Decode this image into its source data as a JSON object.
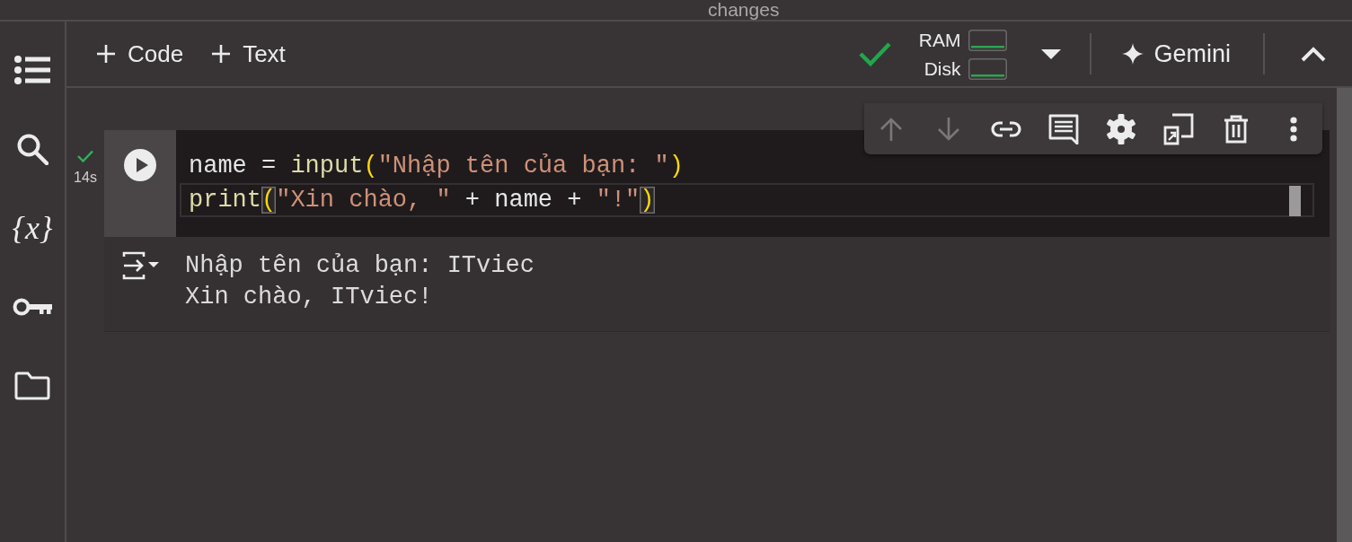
{
  "header": {
    "text": "changes"
  },
  "sidebar": {
    "variables_label": "{x}"
  },
  "toolbar": {
    "buttons": [
      {
        "label": "Code"
      },
      {
        "label": "Text"
      }
    ],
    "runtime": {
      "connected": true,
      "meters": [
        {
          "label": "RAM"
        },
        {
          "label": "Disk"
        }
      ]
    },
    "gemini": {
      "label": "Gemini"
    }
  },
  "cell": {
    "finished": true,
    "duration": "14s",
    "lines": [
      {
        "active": false,
        "tokens": [
          {
            "kind": "name",
            "text": "name"
          },
          {
            "kind": "operator",
            "text": " = "
          },
          {
            "kind": "function",
            "text": "input"
          },
          {
            "kind": "bracket",
            "text": "(",
            "matched": false
          },
          {
            "kind": "string",
            "text": "\"Nhập tên của bạn: \""
          },
          {
            "kind": "bracket",
            "text": ")",
            "matched": false
          }
        ]
      },
      {
        "active": true,
        "tokens": [
          {
            "kind": "function",
            "text": "print"
          },
          {
            "kind": "bracket",
            "text": "(",
            "matched": true
          },
          {
            "kind": "string",
            "text": "\"Xin chào, \""
          },
          {
            "kind": "operator",
            "text": " + "
          },
          {
            "kind": "name",
            "text": "name"
          },
          {
            "kind": "operator",
            "text": " + "
          },
          {
            "kind": "string",
            "text": "\"!\""
          },
          {
            "kind": "bracket",
            "text": ")",
            "matched": true
          }
        ]
      }
    ],
    "toolbar": {
      "buttons": [
        {
          "disabled": true
        },
        {
          "disabled": true
        },
        {
          "disabled": false
        },
        {
          "disabled": false
        },
        {
          "disabled": false
        },
        {
          "disabled": false
        },
        {
          "disabled": false
        },
        {
          "disabled": false
        }
      ]
    },
    "output": {
      "lines": [
        "Nhập tên của bạn: ITviec",
        "Xin chào, ITviec!"
      ]
    }
  }
}
